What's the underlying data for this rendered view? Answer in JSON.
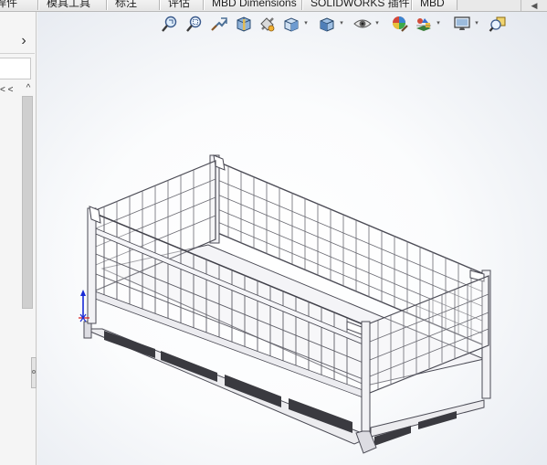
{
  "tabs": [
    {
      "label": "焊件"
    },
    {
      "label": "模具工具"
    },
    {
      "label": "标注"
    },
    {
      "label": "评估"
    },
    {
      "label": "MBD Dimensions"
    },
    {
      "label": "SOLIDWORKS 插件"
    },
    {
      "label": "MBD"
    }
  ],
  "tab_scroll_label": "◀",
  "left_panel": {
    "expand_glyph": "›",
    "tree_text": "< <",
    "scroll_up_glyph": "^"
  },
  "heads_up_toolbar": {
    "icons": [
      "zoom-to-fit-icon",
      "zoom-to-area-icon",
      "previous-view-icon",
      "section-view-icon",
      "dynamic-annotation-views-icon",
      "view-orientation-icon",
      "display-style-icon",
      "hide-show-items-icon",
      "edit-appearance-icon",
      "apply-scene-icon",
      "view-settings-icon",
      "rotate-view-icon"
    ],
    "caret_glyph": "▾"
  },
  "colors": {
    "frame_stroke": "#4b4b55",
    "mesh_stroke": "#6a6a72",
    "floor_fill": "#f4f4f7",
    "dark_panel": "#3a3a40",
    "triad_blue": "#1a2bd6",
    "triad_red": "#d61a1a"
  }
}
